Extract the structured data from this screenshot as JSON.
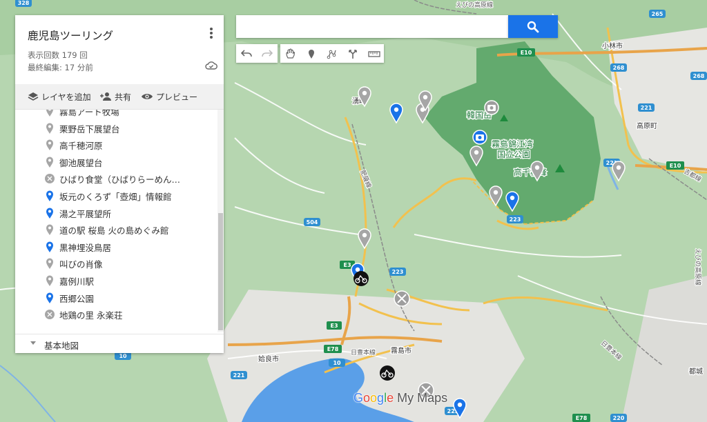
{
  "panel": {
    "title": "鹿児島ツーリング",
    "view_count": "表示回数 179 回",
    "last_edit": "最終編集: 17 分前",
    "actions": {
      "add_layer": "レイヤを追加",
      "share": "共有",
      "preview": "プレビュー"
    },
    "items": [
      {
        "label": "霧島アート牧場",
        "icon": "gray-pin-icon"
      },
      {
        "label": "栗野岳下展望台",
        "icon": "gray-pin-icon"
      },
      {
        "label": "高千穂河原",
        "icon": "gray-pin-icon"
      },
      {
        "label": "御池展望台",
        "icon": "gray-pin-icon"
      },
      {
        "label": "ひばり食堂（ひばりらーめん…",
        "icon": "restaurant-icon"
      },
      {
        "label": "坂元のくろず「壺畑」情報館",
        "icon": "blue-pin-icon"
      },
      {
        "label": "湯之平展望所",
        "icon": "blue-pin-icon"
      },
      {
        "label": "道の駅 桜島 火の島めぐみ館",
        "icon": "gray-pin-icon"
      },
      {
        "label": "黒神埋没鳥居",
        "icon": "blue-pin-icon"
      },
      {
        "label": "叫びの肖像",
        "icon": "gray-pin-icon"
      },
      {
        "label": "嘉例川駅",
        "icon": "gray-pin-icon"
      },
      {
        "label": "西郷公園",
        "icon": "blue-pin-icon"
      },
      {
        "label": "地鶏の里 永楽荘",
        "icon": "restaurant-icon"
      }
    ],
    "basemap_label": "基本地図"
  },
  "search": {
    "value": "",
    "placeholder": ""
  },
  "map": {
    "labels": {
      "kobayashi": "小林市",
      "takaharu": "高原町",
      "kirishima_city": "霧島市",
      "aira_city": "姶良市",
      "karakunidake": "韓国岳",
      "park_line1": "霧島錦江湾",
      "park_line2": "国立公園",
      "takachiho": "高千穂峰",
      "yu_town": "湧町",
      "miyakonojo": "都城",
      "hisatsu_line": "肥薩線",
      "nippo_line": "日豊本線",
      "nippo_line2": "日豊本線",
      "kitto_line": "吉都線",
      "ebino_kogen_line": "えびの高原線",
      "ebino_kogen_line2": "えびの高原線"
    },
    "shields": [
      "328",
      "265",
      "268",
      "268",
      "221",
      "221",
      "223",
      "223",
      "223",
      "504",
      "10",
      "10",
      "221",
      "220"
    ],
    "expressway_shields": [
      "E10",
      "E10",
      "E3",
      "E3",
      "E78",
      "E78"
    ],
    "colors": {
      "park": "#5fa86a",
      "terrain": "#a5cea0",
      "water": "#5a9fe8",
      "blue_pin": "#1a73e8",
      "gray_pin": "#9e9e9e",
      "highway": "#f2c14e"
    }
  },
  "branding": {
    "google": "Google",
    "mymaps": " My Maps"
  }
}
